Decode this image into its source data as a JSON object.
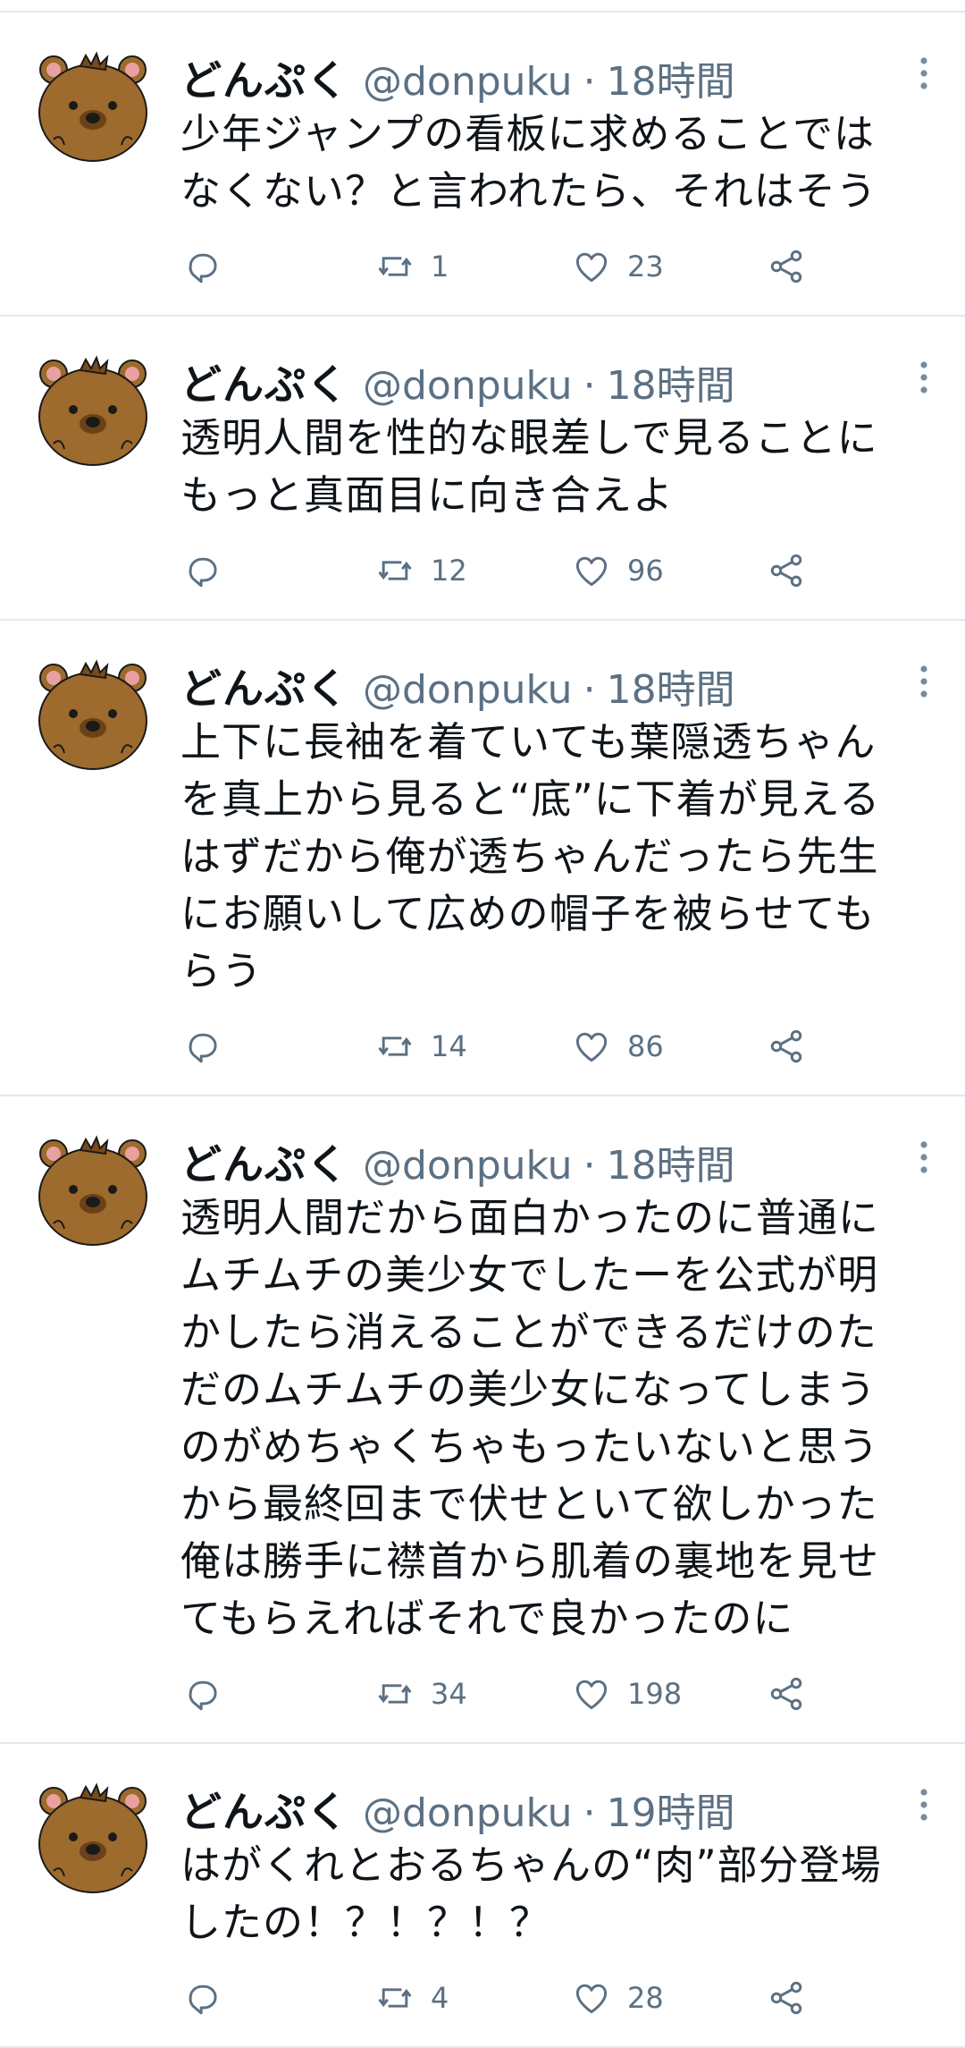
{
  "tweets": [
    {
      "display_name": "どんぷく",
      "handle": "@donpuku",
      "separator": "·",
      "time": "18時間",
      "text": "少年ジャンプの看板に求めることでは\nなくない？と言われたら、それはそう",
      "retweets": "1",
      "likes": "23"
    },
    {
      "display_name": "どんぷく",
      "handle": "@donpuku",
      "separator": "·",
      "time": "18時間",
      "text": "透明人間を性的な眼差しで見ることに\nもっと真面目に向き合えよ",
      "retweets": "12",
      "likes": "96"
    },
    {
      "display_name": "どんぷく",
      "handle": "@donpuku",
      "separator": "·",
      "time": "18時間",
      "text": "上下に長袖を着ていても葉隠透ちゃん\nを真上から見ると“底”に下着が見える\nはずだから俺が透ちゃんだったら先生\nにお願いして広めの帽子を被らせても\nらう",
      "retweets": "14",
      "likes": "86"
    },
    {
      "display_name": "どんぷく",
      "handle": "@donpuku",
      "separator": "·",
      "time": "18時間",
      "text": "透明人間だから面白かったのに普通に\nムチムチの美少女でしたーを公式が明\nかしたら消えることができるだけのた\nだのムチムチの美少女になってしまう\nのがめちゃくちゃもったいないと思う\nから最終回まで伏せといて欲しかった\n俺は勝手に襟首から肌着の裏地を見せ\nてもらえればそれで良かったのに",
      "retweets": "34",
      "likes": "198"
    },
    {
      "display_name": "どんぷく",
      "handle": "@donpuku",
      "separator": "·",
      "time": "19時間",
      "text": "はがくれとおるちゃんの“肉”部分登場\nしたの！？！？！？",
      "retweets": "4",
      "likes": "28"
    }
  ],
  "icons": {
    "avatar": "bear-avatar",
    "more": "more-vertical-icon",
    "reply": "reply-icon",
    "retweet": "retweet-icon",
    "like": "heart-icon",
    "share": "share-icon"
  },
  "colors": {
    "text": "#0f1419",
    "secondary": "#5b7083",
    "divider": "#e1e8ed",
    "avatar_brown": "#9c6b2d"
  }
}
